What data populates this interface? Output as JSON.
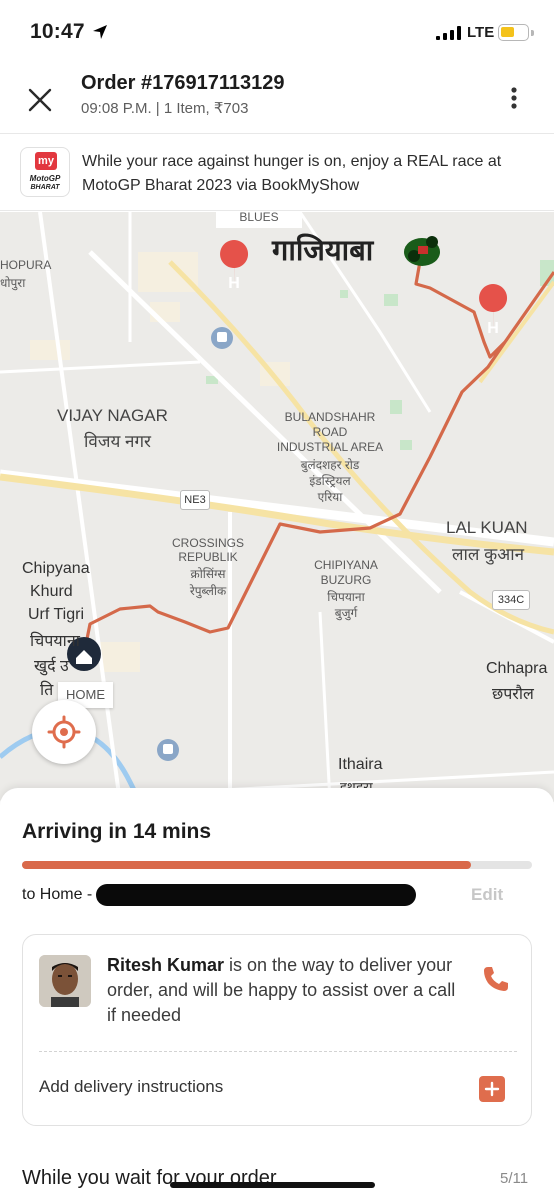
{
  "status_bar": {
    "time": "10:47",
    "network": "LTE"
  },
  "header": {
    "title": "Order #176917113129",
    "subtitle": "09:08 P.M. | 1 Item, ₹703"
  },
  "promo": {
    "logo_text_1": "my",
    "logo_text_2": "MotoGP",
    "logo_text_3": "BHARAT",
    "text": "While your race against hunger is on, enjoy a REAL race at MotoGP Bharat 2023 via BookMyShow"
  },
  "map": {
    "labels": {
      "blues": "BLUES",
      "ghaziabad": "गाजियाबा",
      "hopura": "HOPURA",
      "hopura_hi": "धोपुरा",
      "vijay": "VIJAY NAGAR",
      "vijay_hi": "विजय नगर",
      "bulandshahr_1": "BULANDSHAHR",
      "bulandshahr_2": "ROAD",
      "bulandshahr_3": "INDUSTRIAL AREA",
      "bulandshahr_hi_1": "बुलंदशहर रोड",
      "bulandshahr_hi_2": "इंडस्ट्रियल",
      "bulandshahr_hi_3": "एरिया",
      "ne3": "NE3",
      "lal_kuan": "LAL KUAN",
      "lal_kuan_hi": "लाल कुआन",
      "crossings_1": "CROSSINGS",
      "crossings_2": "REPUBLIK",
      "crossings_hi_1": "क्रोसिंग्स",
      "crossings_hi_2": "रेपुब्लीक",
      "chipiyana_1": "CHIPIYANA",
      "chipiyana_2": "BUZURG",
      "chipiyana_hi_1": "चिपयाना",
      "chipiyana_hi_2": "बुजुर्ग",
      "chipyana_k_1": "Chipyana",
      "chipyana_k_2": "Khurd",
      "chipyana_k_3": "Urf Tigri",
      "chipyana_k_hi_1": "चिपयाना",
      "chipyana_k_hi_2": "खुर्द उ",
      "chipyana_k_hi_3": "ति",
      "road_334c": "334C",
      "chhapra": "Chhapra",
      "chhapra_hi": "छपरौल",
      "ithaira": "Ithaira",
      "ithaira_hi": "इथहरा",
      "home": "HOME"
    },
    "route_color": "#d4694a"
  },
  "delivery": {
    "status": "Arriving in 14 mins",
    "progress": 0.88,
    "to_label": "to Home -",
    "edit_label": "Edit"
  },
  "rider": {
    "name": "Ritesh Kumar",
    "message": " is on the way to deliver your order, and will be happy to assist over a call if needed",
    "instructions_label": "Add delivery instructions"
  },
  "wait": {
    "title": "While you wait for your order",
    "count": "5/11"
  },
  "colors": {
    "accent": "#df6d4d",
    "route": "#d4694a",
    "progress_track": "#e4e4e4"
  }
}
